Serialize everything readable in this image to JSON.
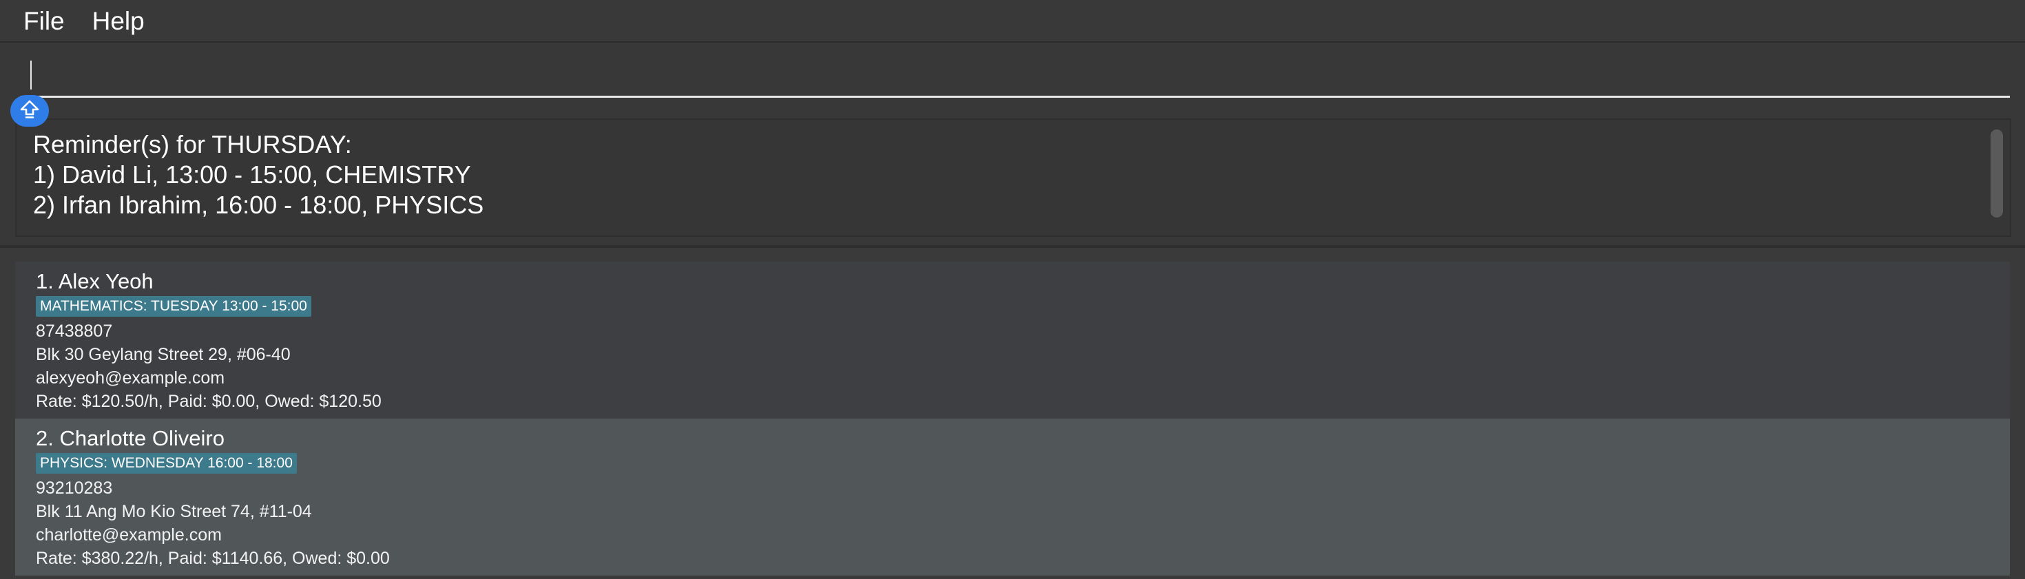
{
  "menu": {
    "file_label": "File",
    "help_label": "Help"
  },
  "command": {
    "value": "",
    "placeholder": ""
  },
  "icons": {
    "shift_button": "upload-arrow-icon"
  },
  "colors": {
    "accent": "#2f7de8",
    "tag_bg": "#3d7a8c",
    "background": "#383838",
    "card_odd": "#3d3f42",
    "card_even": "#515658"
  },
  "reminder": {
    "heading": "Reminder(s) for THURSDAY:",
    "lines": [
      "1) David Li, 13:00 - 15:00, CHEMISTRY",
      "2) Irfan Ibrahim, 16:00 - 18:00, PHYSICS"
    ]
  },
  "persons": [
    {
      "name": "1. Alex Yeoh",
      "tag": "MATHEMATICS: TUESDAY 13:00 - 15:00",
      "phone": "87438807",
      "address": "Blk 30 Geylang Street 29, #06-40",
      "email": "alexyeoh@example.com",
      "rate": "Rate: $120.50/h, Paid: $0.00, Owed: $120.50"
    },
    {
      "name": "2. Charlotte Oliveiro",
      "tag": "PHYSICS: WEDNESDAY 16:00 - 18:00",
      "phone": "93210283",
      "address": "Blk 11 Ang Mo Kio Street 74, #11-04",
      "email": "charlotte@example.com",
      "rate": "Rate: $380.22/h, Paid: $1140.66, Owed: $0.00"
    }
  ]
}
